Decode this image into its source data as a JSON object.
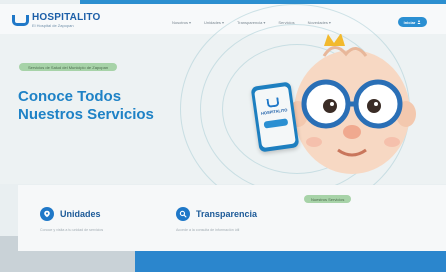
{
  "header": {
    "brand": "HOSPITALITO",
    "brand_sub": "El Hospital de Zapopan",
    "nav": [
      {
        "label": "Nosotros"
      },
      {
        "label": "Unidades"
      },
      {
        "label": "Transparencia"
      },
      {
        "label": "Servicios"
      },
      {
        "label": "Novedades"
      }
    ],
    "login_label": "Iniciar"
  },
  "hero": {
    "badge": "Servicios de Salud del Municipio de Zapopan",
    "title_line1": "Conoce Todos",
    "title_line2": "Nuestros Servicios",
    "phone_brand": "HOSPITALITO"
  },
  "services": {
    "badge": "Nuestros Servicios",
    "cards": [
      {
        "title": "Unidades",
        "text": "Conoce y visita a tu unidad de servicios",
        "icon": "location-icon"
      },
      {
        "title": "Transparencia",
        "text": "Accede a la consulta de información útil",
        "icon": "search-icon"
      }
    ]
  },
  "colors": {
    "primary": "#1e82c6",
    "accent_green": "#a7d3a8",
    "button": "#2a8fd2"
  }
}
